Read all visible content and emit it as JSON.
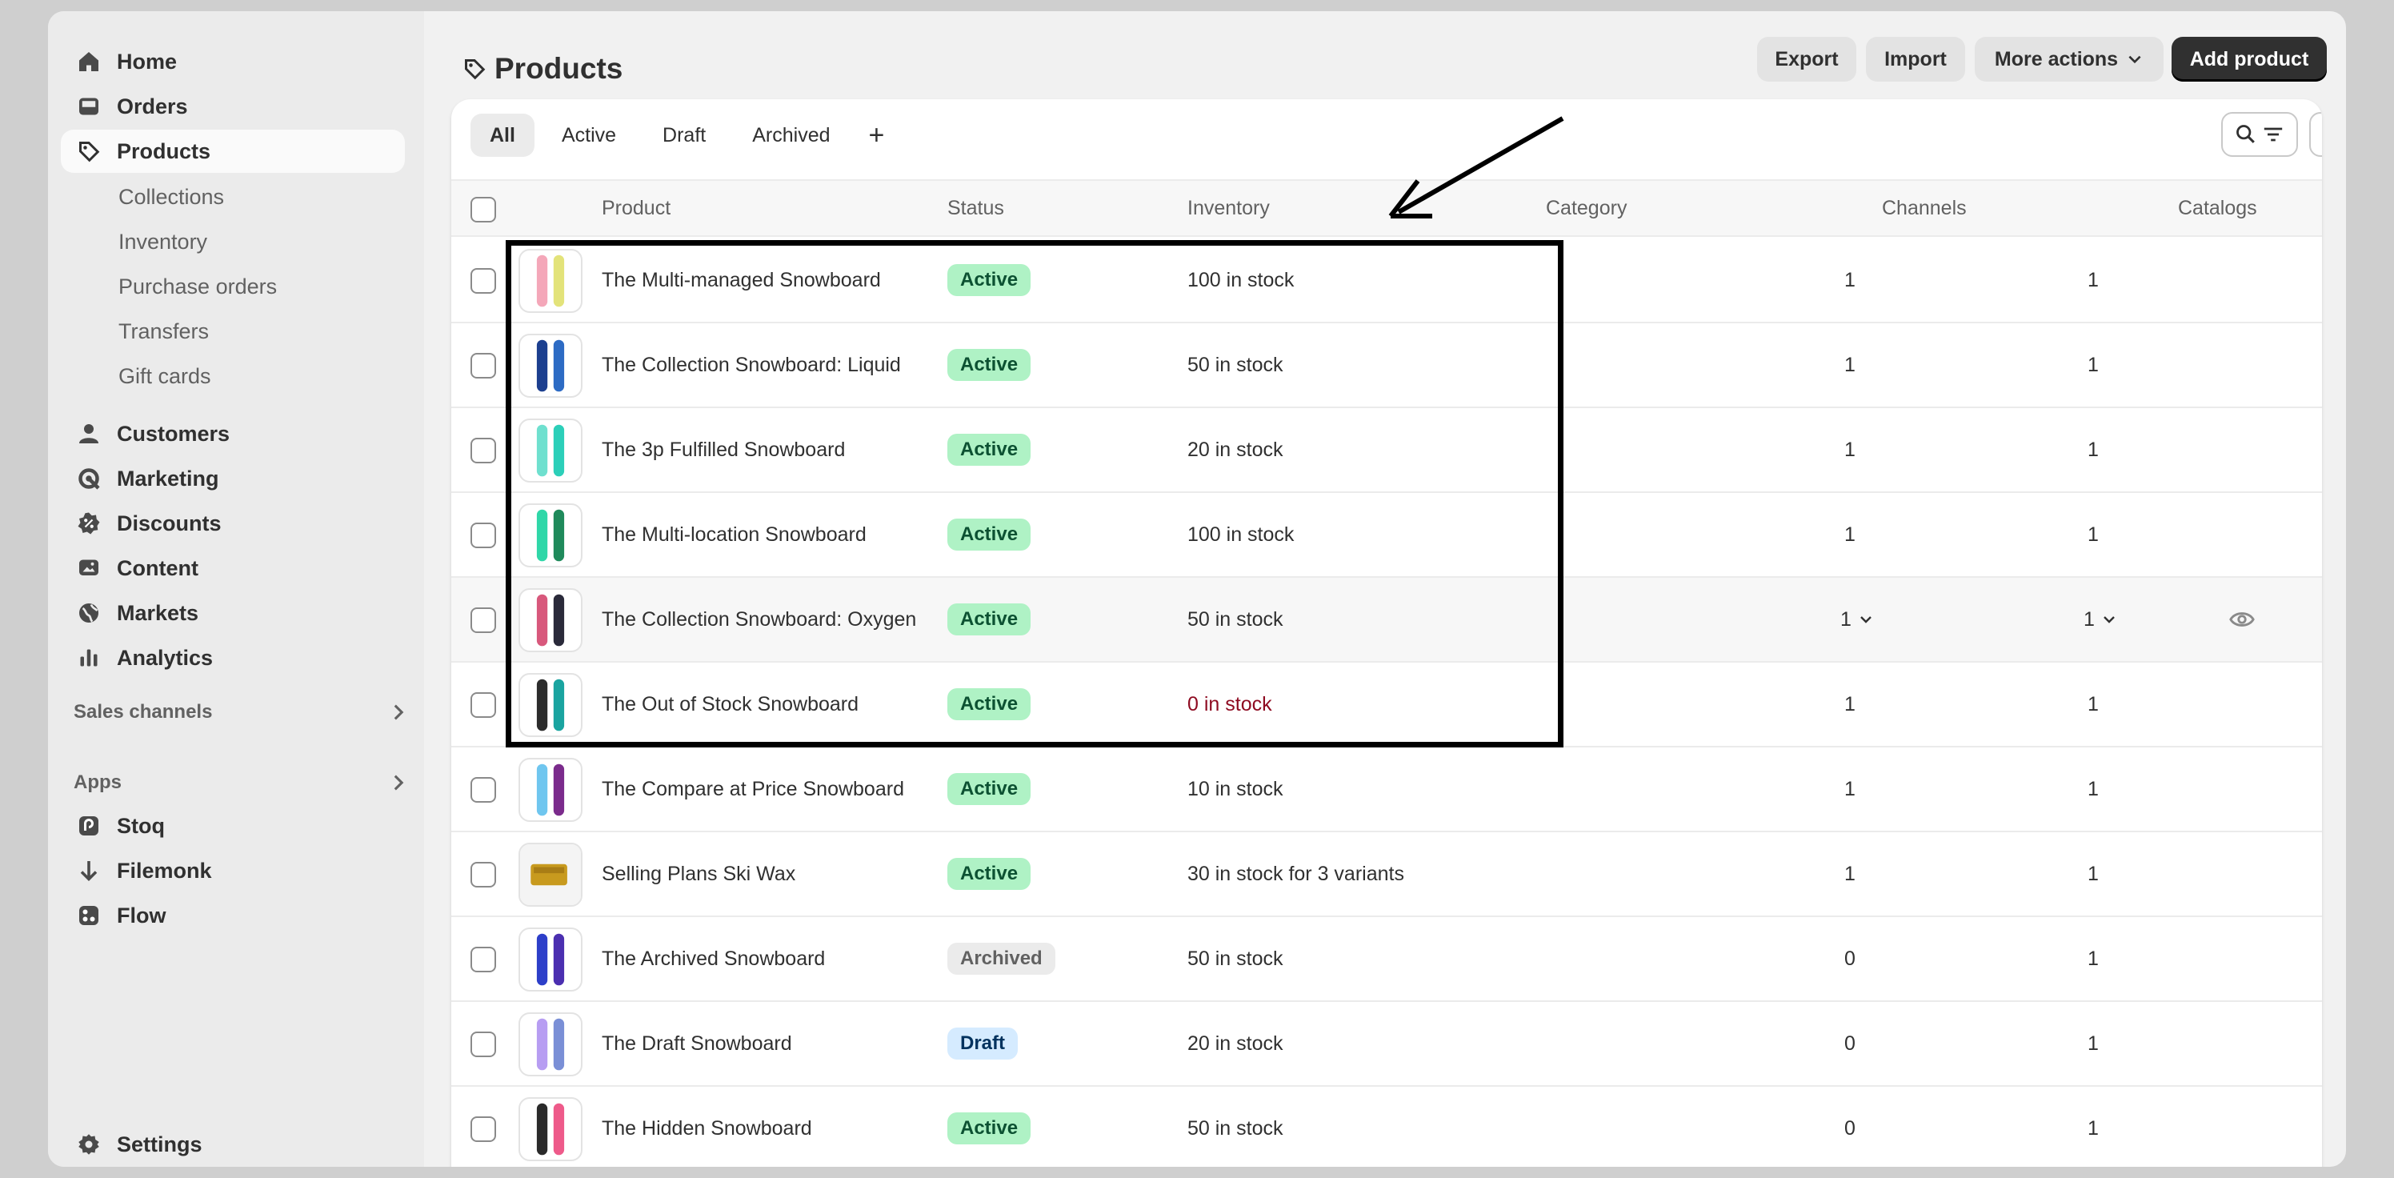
{
  "sidebar": {
    "nav_main": [
      {
        "label": "Home",
        "icon": "home-icon"
      },
      {
        "label": "Orders",
        "icon": "inbox-icon"
      },
      {
        "label": "Products",
        "icon": "tag-icon",
        "selected": true
      }
    ],
    "sub_items": [
      "Collections",
      "Inventory",
      "Purchase orders",
      "Transfers",
      "Gift cards"
    ],
    "nav_secondary": [
      {
        "label": "Customers",
        "icon": "person-icon"
      },
      {
        "label": "Marketing",
        "icon": "target-icon"
      },
      {
        "label": "Discounts",
        "icon": "discount-icon"
      },
      {
        "label": "Content",
        "icon": "image-icon"
      },
      {
        "label": "Markets",
        "icon": "globe-icon"
      },
      {
        "label": "Analytics",
        "icon": "bar-chart-icon"
      }
    ],
    "sales_channels_label": "Sales channels",
    "apps_label": "Apps",
    "apps": [
      {
        "label": "Stoq",
        "icon": "stoq-app-icon"
      },
      {
        "label": "Filemonk",
        "icon": "download-arrow-icon"
      },
      {
        "label": "Flow",
        "icon": "flow-app-icon"
      }
    ],
    "settings_label": "Settings"
  },
  "header": {
    "title": "Products",
    "export_label": "Export",
    "import_label": "Import",
    "more_actions_label": "More actions",
    "add_product_label": "Add product"
  },
  "tabs": [
    {
      "label": "All",
      "selected": true
    },
    {
      "label": "Active"
    },
    {
      "label": "Draft"
    },
    {
      "label": "Archived"
    },
    {
      "label": "+"
    }
  ],
  "table": {
    "columns": [
      "Product",
      "Status",
      "Inventory",
      "Category",
      "Channels",
      "Catalogs"
    ],
    "rows": [
      {
        "product": "The Multi-managed Snowboard",
        "status": "Active",
        "inventory": "100 in stock",
        "channels": "1",
        "catalogs": "1",
        "colors": [
          "#f4a7b9",
          "#e3e37a"
        ]
      },
      {
        "product": "The Collection Snowboard: Liquid",
        "status": "Active",
        "inventory": "50 in stock",
        "channels": "1",
        "catalogs": "1",
        "colors": [
          "#1c3f8f",
          "#2d6bc4"
        ]
      },
      {
        "product": "The 3p Fulfilled Snowboard",
        "status": "Active",
        "inventory": "20 in stock",
        "channels": "1",
        "catalogs": "1",
        "colors": [
          "#6fe0cf",
          "#2ccfb9"
        ]
      },
      {
        "product": "The Multi-location Snowboard",
        "status": "Active",
        "inventory": "100 in stock",
        "channels": "1",
        "catalogs": "1",
        "colors": [
          "#2fd7a8",
          "#1f8a5b"
        ]
      },
      {
        "product": "The Collection Snowboard: Oxygen",
        "status": "Active",
        "inventory": "50 in stock",
        "channels": "1",
        "catalogs": "1",
        "colors": [
          "#d8587c",
          "#2a2a3a"
        ],
        "hover": true
      },
      {
        "product": "The Out of Stock Snowboard",
        "status": "Active",
        "inventory": "0 in stock",
        "channels": "1",
        "catalogs": "1",
        "colors": [
          "#2c2c2c",
          "#1aa4a0"
        ],
        "out_of_stock": true
      },
      {
        "product": "The Compare at Price Snowboard",
        "status": "Active",
        "inventory": "10 in stock",
        "channels": "1",
        "catalogs": "1",
        "colors": [
          "#6fc6ef",
          "#7b2b8c"
        ]
      },
      {
        "product": "Selling Plans Ski Wax",
        "status": "Active",
        "inventory": "30 in stock for 3 variants",
        "channels": "1",
        "catalogs": "1",
        "colors": [
          "#c89a1e",
          "#8a5f0b"
        ],
        "wax": true
      },
      {
        "product": "The Archived Snowboard",
        "status": "Archived",
        "inventory": "50 in stock",
        "channels": "0",
        "catalogs": "1",
        "colors": [
          "#2d3fc9",
          "#4b2fb0"
        ]
      },
      {
        "product": "The Draft Snowboard",
        "status": "Draft",
        "inventory": "20 in stock",
        "channels": "0",
        "catalogs": "1",
        "colors": [
          "#b79df2",
          "#7a8fd6"
        ]
      },
      {
        "product": "The Hidden Snowboard",
        "status": "Active",
        "inventory": "50 in stock",
        "channels": "0",
        "catalogs": "1",
        "colors": [
          "#2a2a2a",
          "#ee5a8a"
        ]
      }
    ]
  },
  "colors": {
    "active_badge_bg": "#aff2c5",
    "active_badge_text": "#0c5132",
    "archived_badge_bg": "#ebebeb",
    "draft_badge_bg": "#d5ebff",
    "out_of_stock_text": "#8e0b21",
    "primary_button": "#303030"
  }
}
